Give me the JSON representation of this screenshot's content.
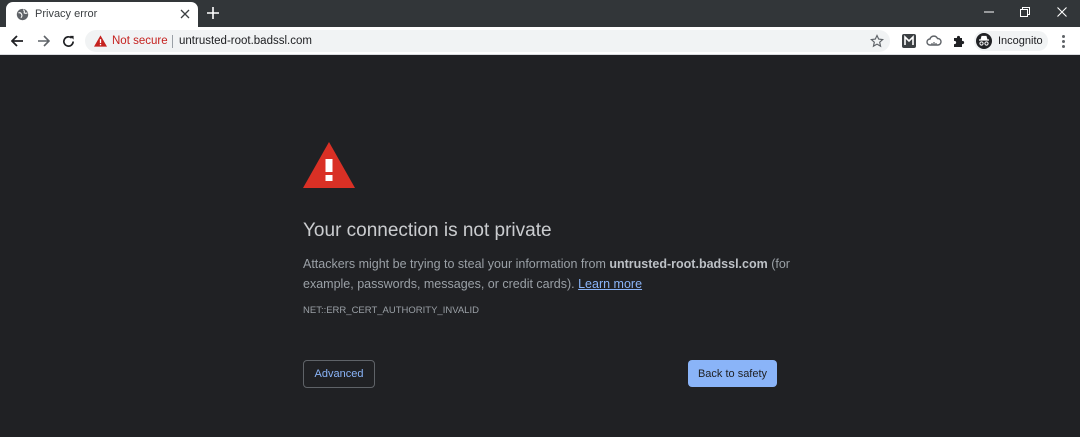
{
  "tab": {
    "title": "Privacy error",
    "favicon": "globe-icon"
  },
  "toolbar": {
    "security_label": "Not secure",
    "url": "untrusted-root.badssl.com",
    "incognito_label": "Incognito"
  },
  "interstitial": {
    "heading": "Your connection is not private",
    "para_prefix": "Attackers might be trying to steal your information from ",
    "para_host": "untrusted-root.badssl.com",
    "para_suffix": " (for example, passwords, messages, or credit cards). ",
    "learn_more": "Learn more",
    "error_code": "NET::ERR_CERT_AUTHORITY_INVALID",
    "advanced_label": "Advanced",
    "back_label": "Back to safety"
  },
  "colors": {
    "background": "#202124",
    "alert_red": "#d93025",
    "link_blue": "#8ab4f8",
    "not_secure_red": "#c5221f"
  }
}
